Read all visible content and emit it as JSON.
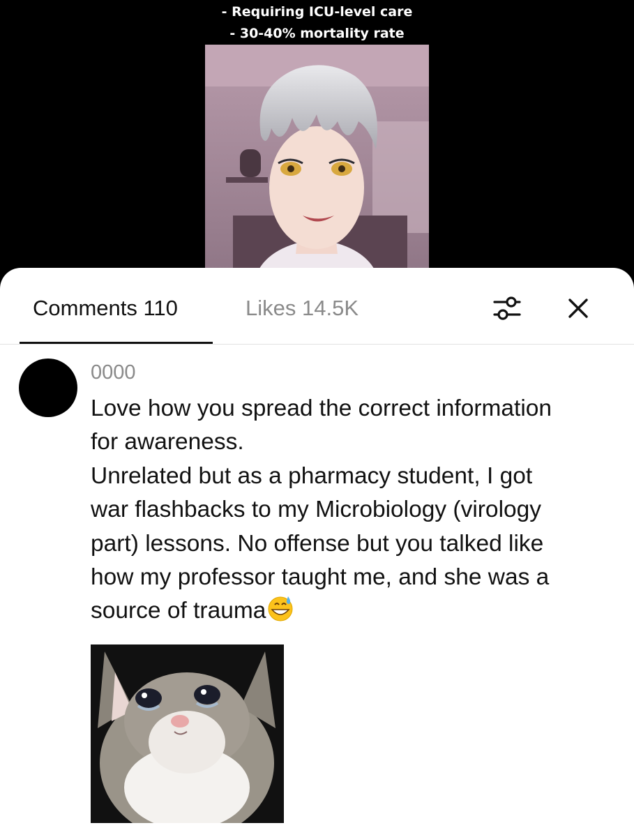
{
  "video": {
    "caption_line1": "- Requiring ICU-level care",
    "caption_line2": "- 30-40% mortality rate"
  },
  "comments_panel": {
    "tabs": [
      {
        "label": "Comments 110",
        "active": true
      },
      {
        "label": "Likes 14.5K",
        "active": false
      }
    ],
    "icons": {
      "filter": "sliders-icon",
      "close": "close-icon"
    },
    "comment": {
      "username": "0000",
      "text_lines": [
        "Love how you spread the correct information\nfor awareness.",
        "Unrelated but as a pharmacy student, I got\nwar flashbacks to my Microbiology (virology\npart) lessons. No offense but you talked like\nhow my professor taught me, and she was a\nsource of trauma"
      ],
      "emoji": "grinning-face-with-sweat-emoji",
      "attachment": "crying-cat-image"
    }
  }
}
